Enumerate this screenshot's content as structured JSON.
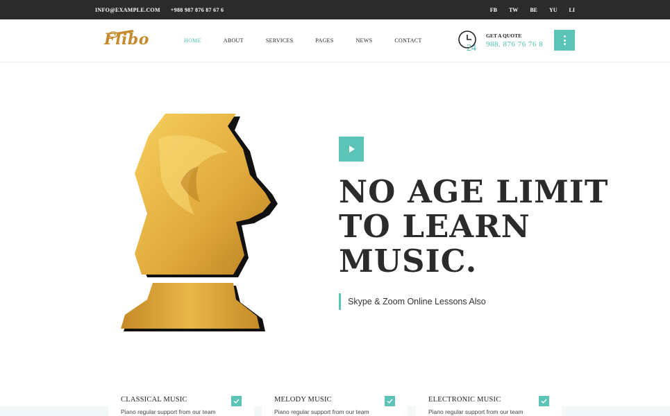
{
  "topbar": {
    "email": "INFO@EXAMPLE.COM",
    "phone": "+988 987 876 87 67 6",
    "social": [
      "FB",
      "TW",
      "BE",
      "YU",
      "LI"
    ]
  },
  "header": {
    "logo_text": "Flibo",
    "nav": [
      "HOME",
      "ABOUT",
      "SERVICES",
      "PAGES",
      "NEWS",
      "CONTACT"
    ],
    "active_nav": "HOME",
    "quote_label": "GET A QUOTE",
    "quote_phone": "988. 876 76 76 8",
    "clock_badge": "24"
  },
  "hero": {
    "headline": [
      "NO AGE LIMIT",
      "TO LEARN",
      "MUSIC."
    ],
    "subline": "Skype & Zoom Online Lessons Also"
  },
  "cards": [
    {
      "title": "CLASSICAL MUSIC",
      "desc": "Piano regular support from our team"
    },
    {
      "title": "MELODY MUSIC",
      "desc": "Piano regular support from our team"
    },
    {
      "title": "ELECTRONIC MUSIC",
      "desc": "Piano regular support from our team"
    }
  ],
  "colors": {
    "accent": "#5cc4b6",
    "topbar": "#2b2b2b",
    "gold": "#d9a23a",
    "headline": "#2b2b2b"
  },
  "icons": {
    "play": "play-icon",
    "menu": "dots-vertical-icon",
    "clock": "clock-24-icon",
    "check": "check-icon"
  }
}
